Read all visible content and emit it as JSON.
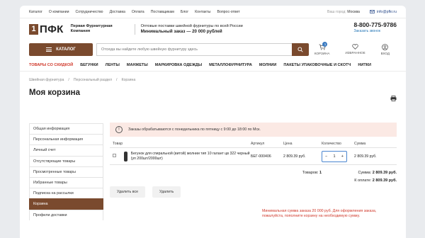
{
  "topbar": {
    "links": [
      "Каталог",
      "О компании",
      "Сотрудничество",
      "Доставка",
      "Оплата",
      "Поставщикам",
      "Блог",
      "Контакты",
      "Вопрос-ответ"
    ],
    "city_label": "Ваш город:",
    "city": "Москва",
    "email": "info@pfkr.ru"
  },
  "header": {
    "logo_digit": "1",
    "logo_text": "ПФК",
    "company_name": "Первая Фурнитурная Компания",
    "tagline": "Оптовые поставки швейной фурнитуры по всей России",
    "min_order": "Минимальный заказ — 20 000 рублей",
    "phone": "8-800-775-9786",
    "callback": "Заказать звонок"
  },
  "search": {
    "catalog_label": "КАТАЛОГ",
    "placeholder": "Отсюда вы найдете любую швейную фурнитуру здесь"
  },
  "header_icons": {
    "cart_label": "КОРЗИНА",
    "cart_count": "1",
    "favorites_label": "ИЗБРАННОЕ",
    "login_label": "ВХОД"
  },
  "nav": {
    "sale": "ТОВАРЫ СО СКИДКОЙ",
    "items": [
      "БЕГУНКИ",
      "ЛЕНТЫ",
      "МАНЖЕТЫ",
      "МАРКИРОВКА ОДЕЖДЫ",
      "МЕТАЛЛОФУРНИТУРА",
      "МОЛНИИ",
      "ПАКЕТЫ УПАКОВОЧНЫЕ И СКОТЧ",
      "НИТКИ"
    ]
  },
  "breadcrumb": [
    "Швейная фурнитура",
    "/",
    "Персональный раздел",
    "/",
    "Корзина"
  ],
  "page_title": "Моя корзина",
  "sidebar": {
    "items": [
      "Общая информация",
      "Персональная информация",
      "Личный счет",
      "Отсутствующие товары",
      "Просмотренные товары",
      "Избранные товары",
      "Подписка на рассылки",
      "Корзина",
      "Профили доставки"
    ],
    "active_index": 7
  },
  "notice": "Заказы обрабатываются с понедельника по пятницу с 9:00 до 18:00 по Мск.",
  "table": {
    "headers": [
      "Товар",
      "Артикул",
      "Цена",
      "Количество",
      "Сумма"
    ],
    "rows": [
      {
        "name": "Бегунок для спиральной (витой) молнии тип 10 галант цв 322 черный (уп 200шт/2000шт)",
        "article": "БЕГ-000406",
        "price": "2 809.39 руб.",
        "quantity": "1",
        "sum": "2 809.39 руб."
      }
    ]
  },
  "totals": {
    "count_label": "Товаров:",
    "count": "1",
    "sum_label": "Сумма:",
    "sum": "2 809.39 руб.",
    "pay_label": "К оплате:",
    "pay": "2 809.39 руб."
  },
  "buttons": {
    "delete_all": "Удалить все",
    "delete": "Удалить"
  },
  "minimum_notice": "Минимальная сумма заказа 20 000 руб. Для оформления заказа, пожалуйста, пополните корзину на необходимую сумму.",
  "colors": {
    "brand": "#7a4a2e",
    "accent_red": "#d0382a",
    "notice_bg": "#fbe9e4",
    "link_blue": "#2a7ab8"
  }
}
